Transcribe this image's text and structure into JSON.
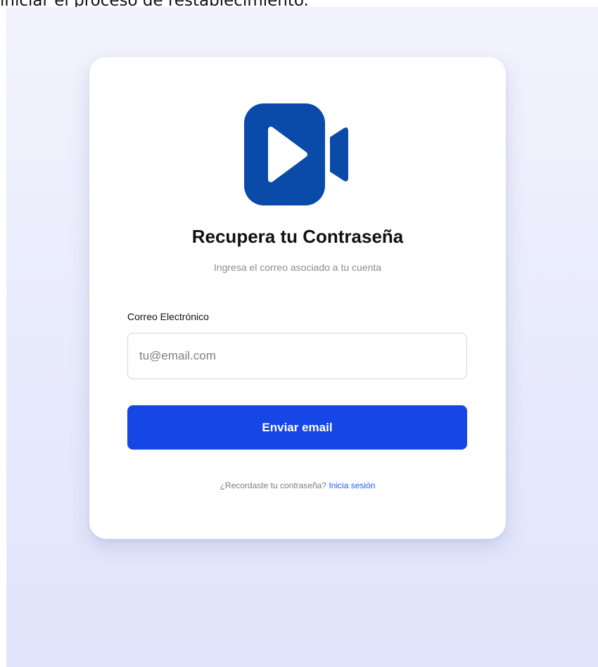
{
  "page": {
    "header_text": "iniciar el proceso de restablecimiento."
  },
  "brand": {
    "logo_icon": "video-camera-play-icon",
    "logo_color": "#0a4aa8"
  },
  "form": {
    "title": "Recupera tu Contraseña",
    "subtitle": "Ingresa el correo asociado a tu cuenta",
    "email_label": "Correo Electrónico",
    "email_value": "",
    "email_placeholder": "tu@email.com",
    "submit_label": "Enviar email",
    "submit_color": "#1746e6"
  },
  "footer": {
    "question": "¿Recordaste tu contraseña?",
    "link_label": "Inicia sesión",
    "link_color": "#1a5cf0"
  }
}
